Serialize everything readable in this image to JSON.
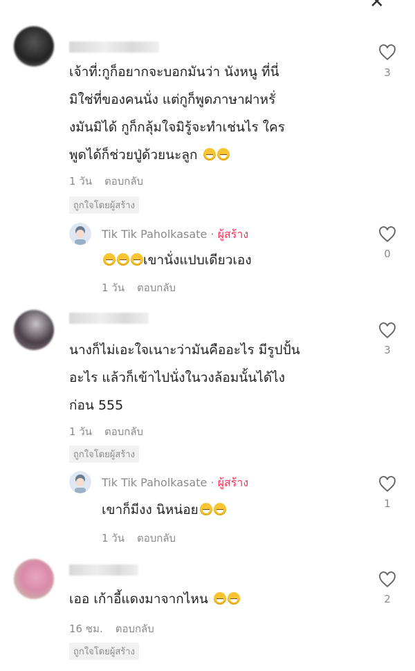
{
  "header": {
    "close_icon": "close-icon"
  },
  "comments": [
    {
      "lines": [
        "เจ้าที่:กูก็อยากจะบอกมันว่า นังหนู ที่นี่",
        "มิใช่ที่ของคนนั่ง แต่กูก็พูดภาษาฝาหรั่",
        "งมันมิได้ กูก็กลุ้มใจมิรู้จะทำเช่นไร ใคร",
        "พูดได้ก็ช่วยปู่ด้วยนะลูก"
      ],
      "time": "1 วัน",
      "reply_label": "ตอบกลับ",
      "liked_by_creator": "ถูกใจโดยผู้สร้าง",
      "likes": "3"
    },
    {
      "lines": [
        "นางก็ไม่เอะใจเนาะว่ามันคืออะไร มีรูปปั้น",
        "อะไร แล้วก็เข้าไปนั่งในวงล้อมนั้นได้ไง",
        "ก่อน 555"
      ],
      "time": "1 วัน",
      "reply_label": "ตอบกลับ",
      "liked_by_creator": "ถูกใจโดยผู้สร้าง",
      "likes": "3"
    },
    {
      "lines": [
        "เออ เก้าอี้แดงมาจากไหน"
      ],
      "time": "16 ชม.",
      "reply_label": "ตอบกลับ",
      "liked_by_creator": "ถูกใจโดยผู้สร้าง",
      "likes": "2"
    }
  ],
  "replies": [
    {
      "author": "Tik Tik Paholkasate",
      "separator": "·",
      "creator_label": "ผู้สร้าง",
      "text": "เขานั่งแปบเดียวเอง",
      "time": "1 วัน",
      "reply_label": "ตอบกลับ",
      "likes": "0"
    },
    {
      "author": "Tik Tik Paholkasate",
      "separator": "·",
      "creator_label": "ผู้สร้าง",
      "text": "เขาก็มีงง นิหน่อย",
      "time": "1 วัน",
      "reply_label": "ตอบกลับ",
      "likes": "1"
    }
  ]
}
